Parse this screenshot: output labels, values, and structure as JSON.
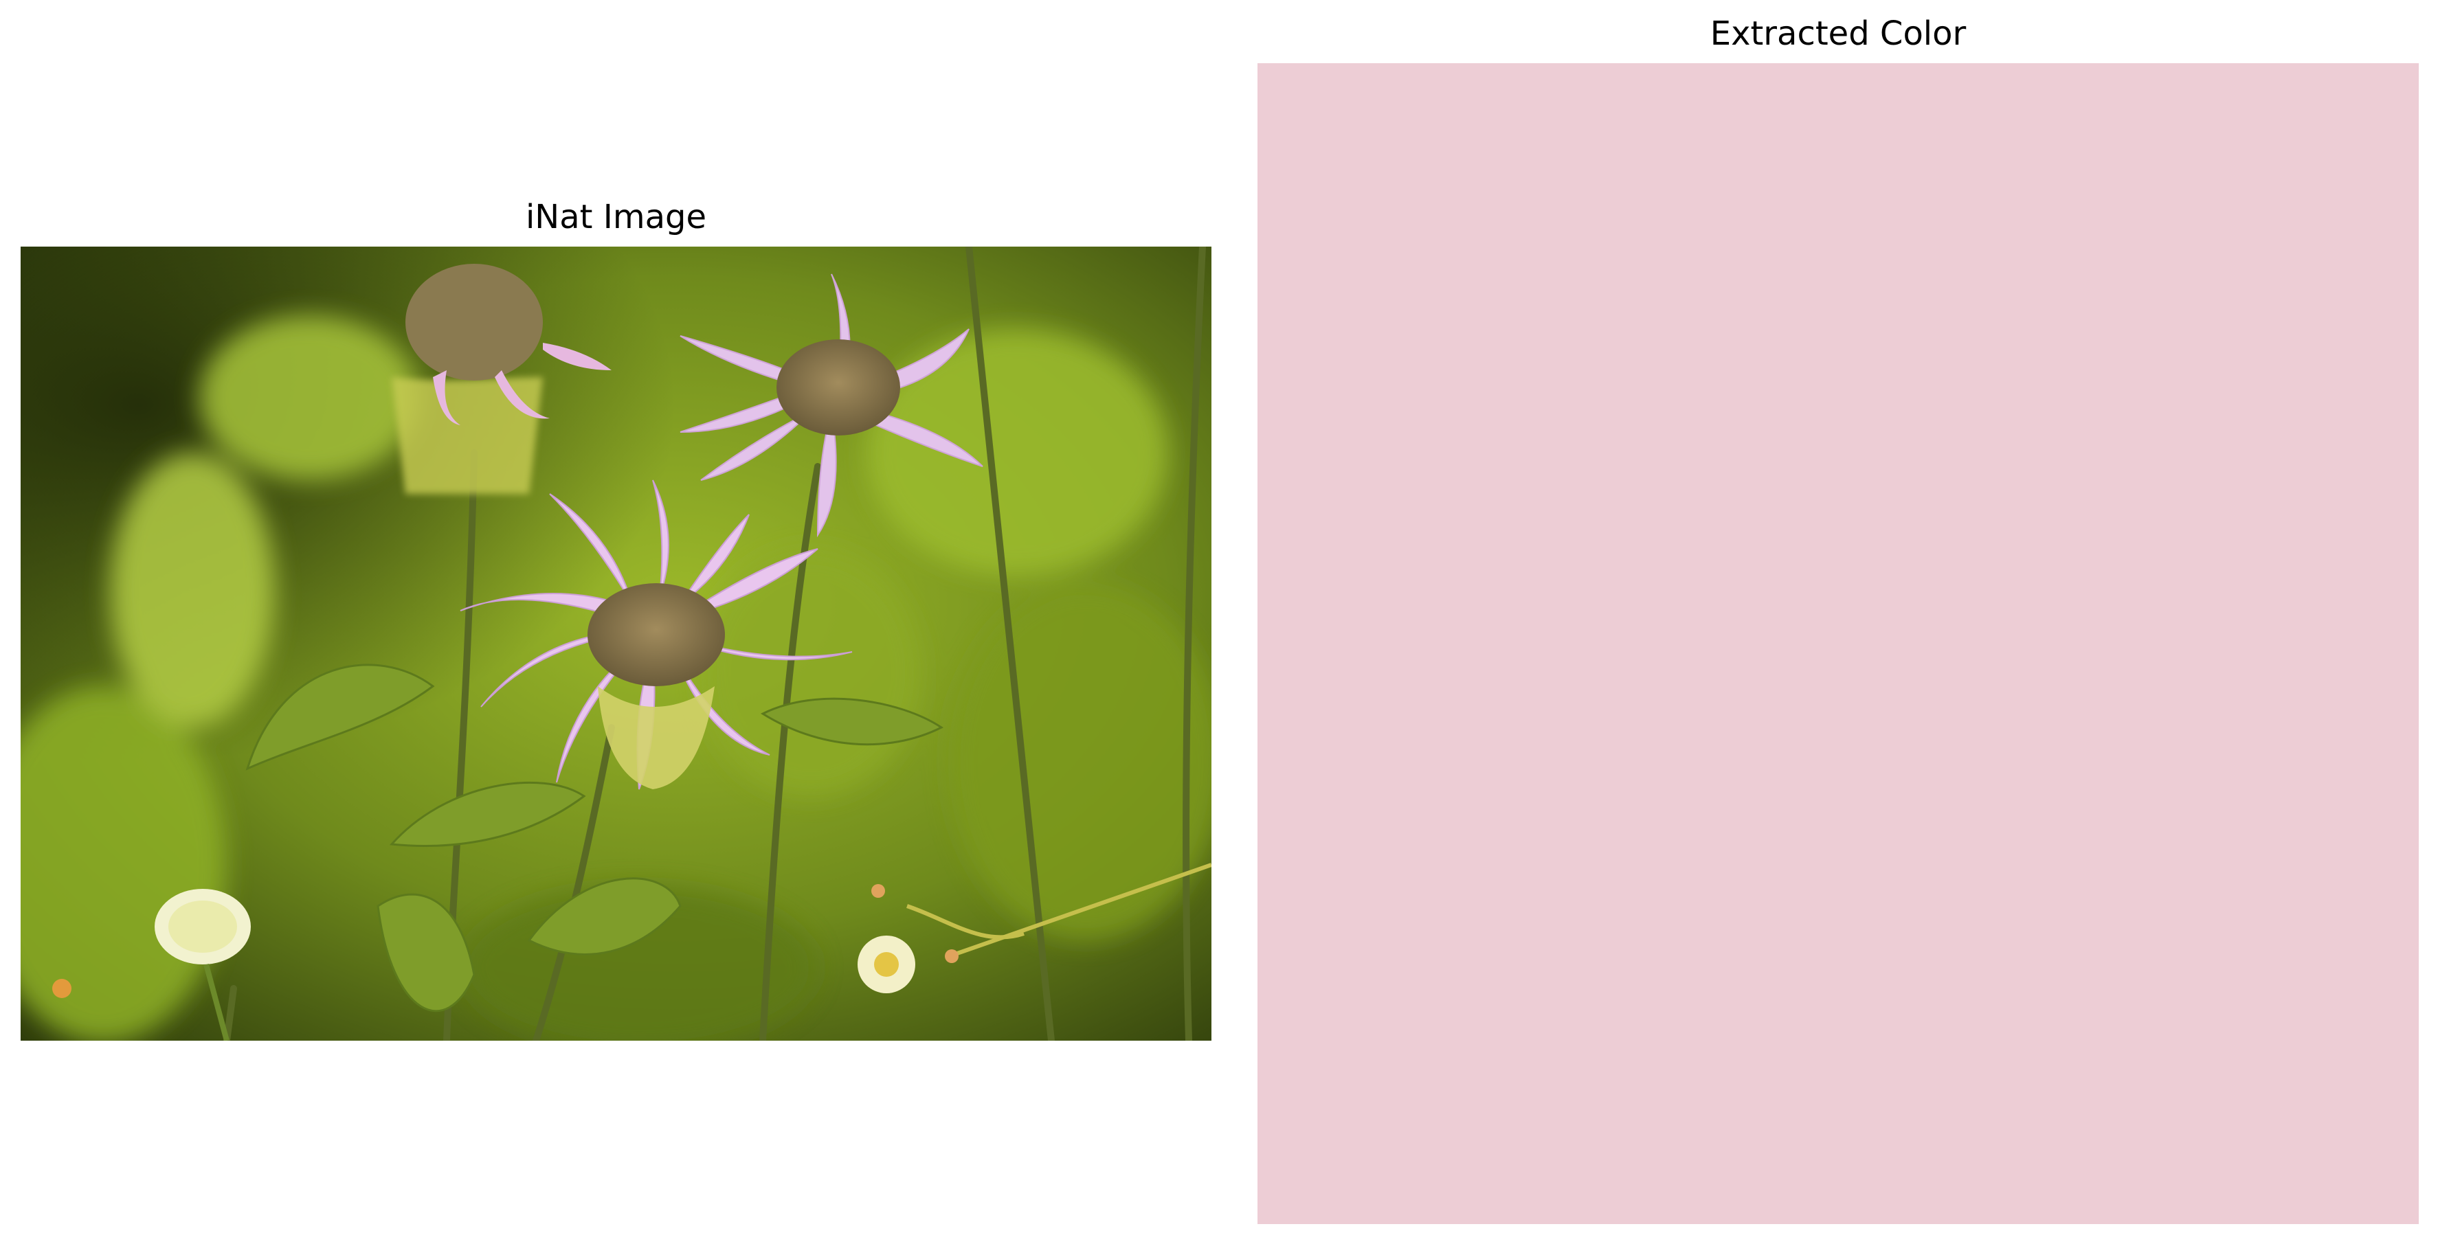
{
  "panels": {
    "left_title": "iNat Image",
    "right_title": "Extracted Color"
  },
  "photo": {
    "subject": "pink wild bergamot flowers with green foliage",
    "background_color": "#6f8a1c"
  },
  "extracted_color": {
    "hex": "#edcdd5"
  }
}
